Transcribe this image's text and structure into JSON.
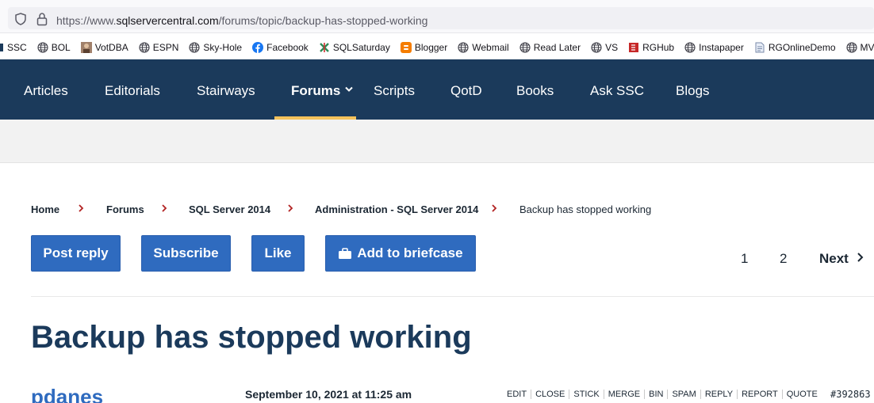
{
  "browser": {
    "url_prefix": "https://www.",
    "url_domain": "sqlservercentral.com",
    "url_path": "/forums/topic/backup-has-stopped-working"
  },
  "bookmarks": [
    {
      "label": "SSC",
      "icon": "ssc-icon"
    },
    {
      "label": "BOL",
      "icon": "globe-icon"
    },
    {
      "label": "VotDBA",
      "icon": "avatar-icon"
    },
    {
      "label": "ESPN",
      "icon": "globe-icon"
    },
    {
      "label": "Sky-Hole",
      "icon": "globe-icon"
    },
    {
      "label": "Facebook",
      "icon": "facebook-icon"
    },
    {
      "label": "SQLSaturday",
      "icon": "sqlsaturday-icon"
    },
    {
      "label": "Blogger",
      "icon": "blogger-icon"
    },
    {
      "label": "Webmail",
      "icon": "globe-icon"
    },
    {
      "label": "Read Later",
      "icon": "globe-icon"
    },
    {
      "label": "VS",
      "icon": "globe-icon"
    },
    {
      "label": "RGHub",
      "icon": "rghub-icon"
    },
    {
      "label": "Instapaper",
      "icon": "globe-icon"
    },
    {
      "label": "RGOnlineDemo",
      "icon": "page-icon"
    },
    {
      "label": "MVP",
      "icon": "globe-icon"
    }
  ],
  "nav": {
    "items": [
      "Articles",
      "Editorials",
      "Stairways",
      "Forums",
      "Scripts",
      "QotD",
      "Books",
      "Ask SSC",
      "Blogs"
    ],
    "active": "Forums",
    "colors": {
      "background": "#1b3a5b",
      "underline": "#f4c25b"
    }
  },
  "breadcrumb": [
    "Home",
    "Forums",
    "SQL Server 2014",
    "Administration - SQL Server 2014",
    "Backup has stopped working"
  ],
  "buttons": {
    "post_reply": "Post reply",
    "subscribe": "Subscribe",
    "like": "Like",
    "add_briefcase": "Add to briefcase",
    "color": "#2f6bbf"
  },
  "pagination": {
    "pages": [
      "1",
      "2"
    ],
    "next": "Next"
  },
  "topic": {
    "title": "Backup has stopped working"
  },
  "post": {
    "author": "pdanes",
    "date": "September 10, 2021 at 11:25 am",
    "actions": [
      "EDIT",
      "CLOSE",
      "STICK",
      "MERGE",
      "BIN",
      "SPAM",
      "REPLY",
      "REPORT",
      "QUOTE"
    ],
    "id": "#392863"
  }
}
